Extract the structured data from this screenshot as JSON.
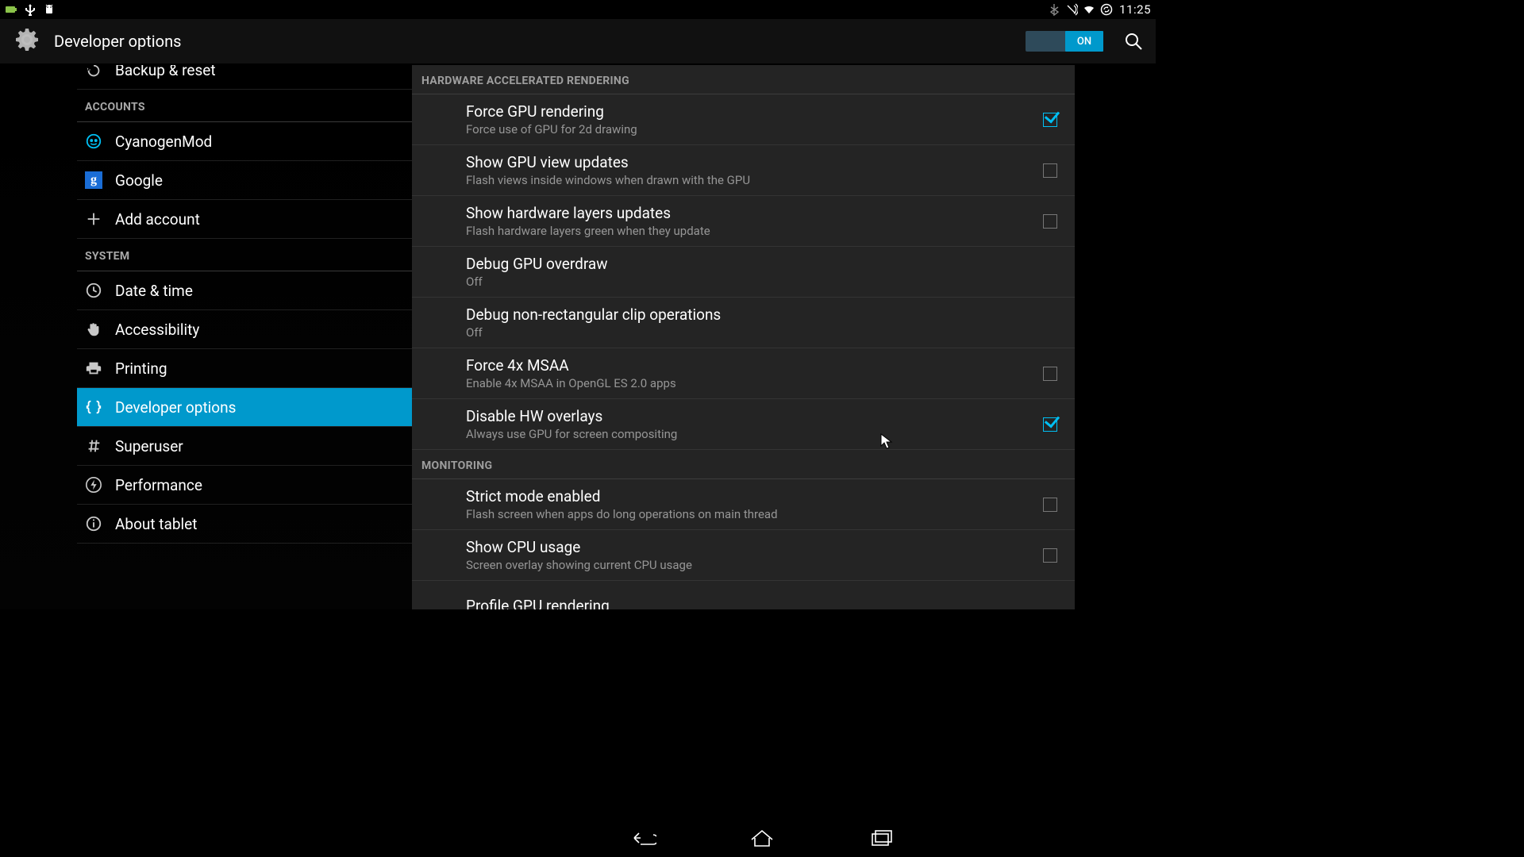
{
  "status": {
    "clock": "11:25"
  },
  "actionbar": {
    "title": "Developer options",
    "switch_label": "ON"
  },
  "sidebar": {
    "item_backup": "Backup & reset",
    "header_accounts": "ACCOUNTS",
    "item_cyanogen": "CyanogenMod",
    "item_google": "Google",
    "item_addaccount": "Add account",
    "header_system": "SYSTEM",
    "item_datetime": "Date & time",
    "item_accessibility": "Accessibility",
    "item_printing": "Printing",
    "item_devoptions": "Developer options",
    "item_superuser": "Superuser",
    "item_performance": "Performance",
    "item_about": "About tablet"
  },
  "detail": {
    "header_hw": "HARDWARE ACCELERATED RENDERING",
    "items_hw": [
      {
        "title": "Force GPU rendering",
        "sub": "Force use of GPU for 2d drawing",
        "checked": true,
        "hasCheck": true
      },
      {
        "title": "Show GPU view updates",
        "sub": "Flash views inside windows when drawn with the GPU",
        "checked": false,
        "hasCheck": true
      },
      {
        "title": "Show hardware layers updates",
        "sub": "Flash hardware layers green when they update",
        "checked": false,
        "hasCheck": true
      },
      {
        "title": "Debug GPU overdraw",
        "sub": "Off",
        "hasCheck": false
      },
      {
        "title": "Debug non-rectangular clip operations",
        "sub": "Off",
        "hasCheck": false
      },
      {
        "title": "Force 4x MSAA",
        "sub": "Enable 4x MSAA in OpenGL ES 2.0 apps",
        "checked": false,
        "hasCheck": true
      },
      {
        "title": "Disable HW overlays",
        "sub": "Always use GPU for screen compositing",
        "checked": true,
        "hasCheck": true
      }
    ],
    "header_mon": "MONITORING",
    "items_mon": [
      {
        "title": "Strict mode enabled",
        "sub": "Flash screen when apps do long operations on main thread",
        "checked": false,
        "hasCheck": true
      },
      {
        "title": "Show CPU usage",
        "sub": "Screen overlay showing current CPU usage",
        "checked": false,
        "hasCheck": true
      },
      {
        "title": "Profile GPU rendering",
        "sub": "",
        "hasCheck": false
      }
    ]
  }
}
